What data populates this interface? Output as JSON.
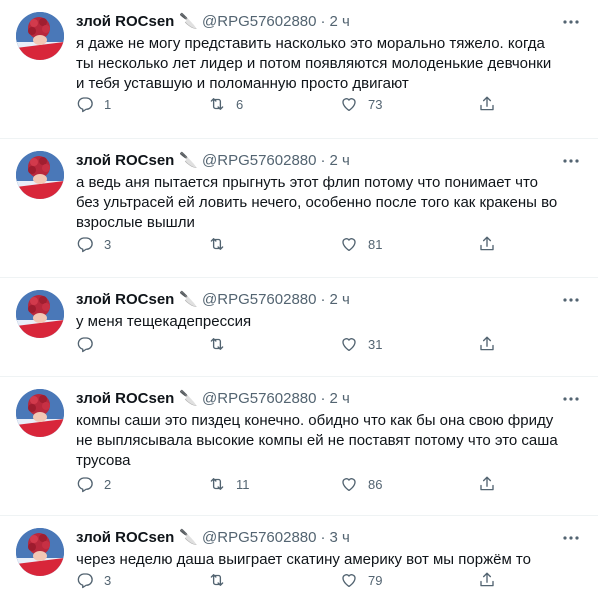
{
  "author": {
    "name": "злой ROCsen",
    "emoji": "🔪",
    "handle": "@RPG57602880",
    "separator": "·"
  },
  "tweets": [
    {
      "time": "2 ч",
      "text": "я даже не могу представить насколько это морально тяжело. когда ты несколько лет лидер и потом появляются молоденькие девчонки и тебя уставшую и поломанную просто двигают",
      "replies": "1",
      "retweets": "6",
      "likes": "73"
    },
    {
      "time": "2 ч",
      "text": "а ведь аня пытается прыгнуть этот  флип потому что понимает что без ультрасей ей ловить нечего, особенно после того как кракены во взрослые вышли",
      "replies": "3",
      "retweets": "",
      "likes": "81"
    },
    {
      "time": "2 ч",
      "text": "у меня тещекадепрессия",
      "replies": "",
      "retweets": "",
      "likes": "31"
    },
    {
      "time": "2 ч",
      "text": "компы саши это пиздец конечно. обидно что как бы она свою фриду не выплясывала высокие компы ей не поставят потому что это саша трусова",
      "replies": "2",
      "retweets": "11",
      "likes": "86"
    },
    {
      "time": "3 ч",
      "text": "через неделю даша выиграет скатину америку вот мы поржём то",
      "replies": "3",
      "retweets": "",
      "likes": "79"
    }
  ],
  "icons": {
    "more": "more-dots-icon",
    "reply": "reply-icon",
    "retweet": "retweet-icon",
    "like": "heart-icon",
    "share": "share-icon"
  },
  "colors": {
    "text": "#0f1419",
    "muted": "#536471",
    "divider": "#eff3f4"
  }
}
